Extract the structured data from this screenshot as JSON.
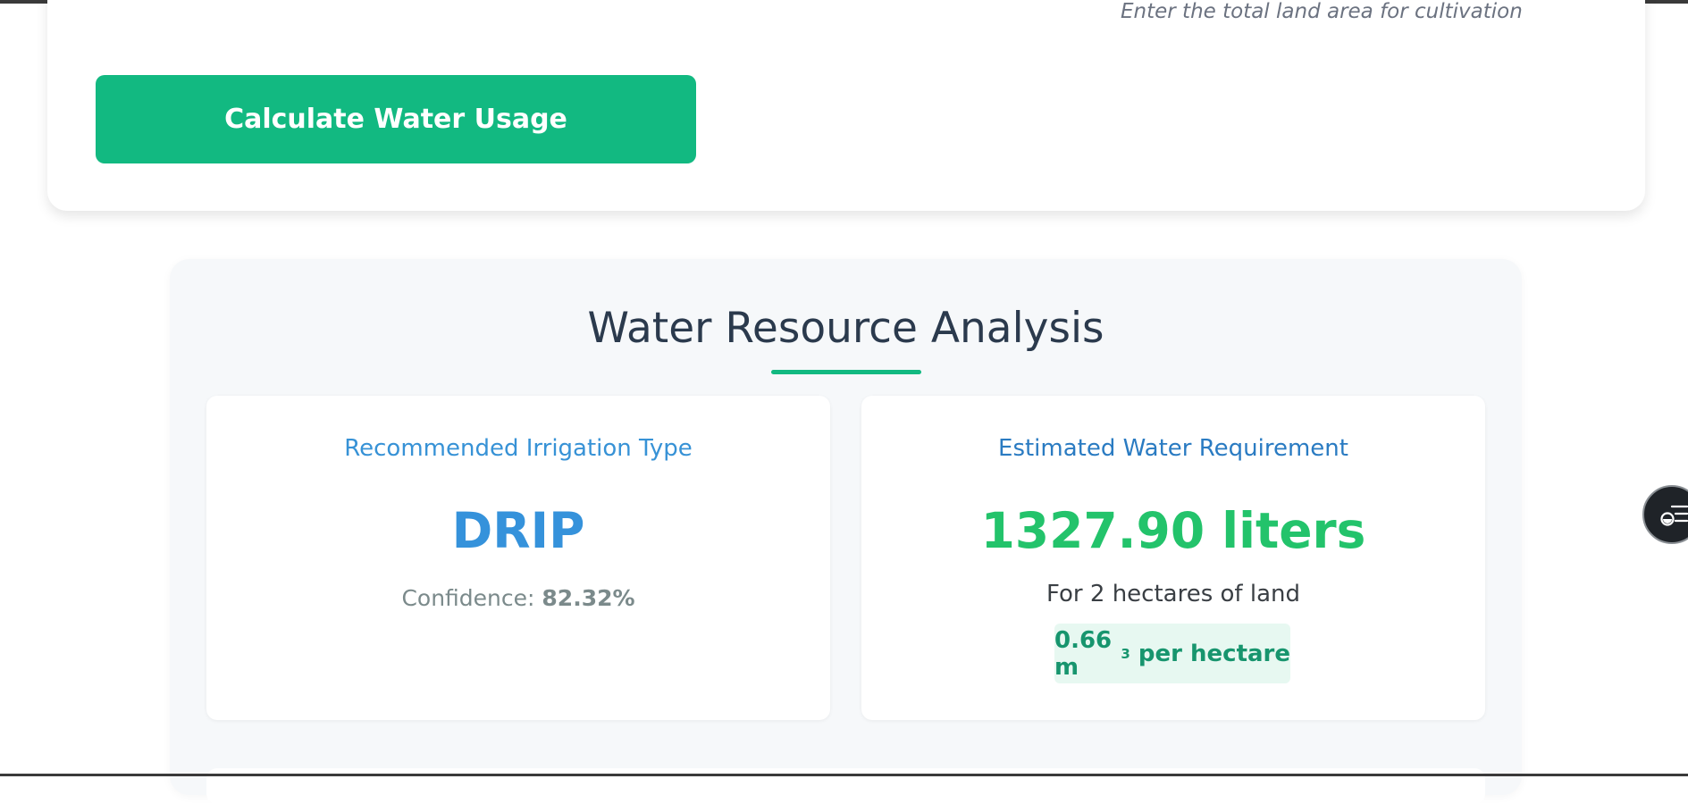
{
  "form": {
    "area_hint": "Enter the total land area for cultivation",
    "calculate_button_label": "Calculate Water Usage"
  },
  "results": {
    "title": "Water Resource Analysis",
    "irrigation_card": {
      "heading": "Recommended Irrigation Type",
      "value": "DRIP",
      "confidence_label": "Confidence:",
      "confidence_value": "82.32%"
    },
    "water_card": {
      "heading": "Estimated Water Requirement",
      "value": "1327.90 liters",
      "land_text": "For 2 hectares of land",
      "per_hectare_value": "0.66 m",
      "per_hectare_sup": "3",
      "per_hectare_suffix": " per hectare"
    }
  },
  "floating_button": {
    "icon": "list-toggle-icon"
  },
  "colors": {
    "accent_green": "#12b981",
    "value_blue": "#3592db",
    "value_green": "#23c36b",
    "title_text": "#2b3a4d"
  }
}
